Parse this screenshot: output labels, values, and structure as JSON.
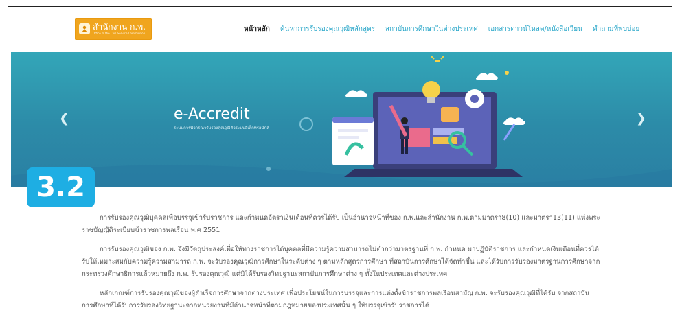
{
  "logo": {
    "title": "สำนักงาน ก.พ.",
    "subtitle": "Office of the Civil Service Commission"
  },
  "nav": {
    "items": [
      {
        "label": "หน้าหลัก",
        "active": true
      },
      {
        "label": "ค้นหาการรับรองคุณวุฒิหลักสูตร",
        "active": false
      },
      {
        "label": "สถาบันการศึกษาในต่างประเทศ",
        "active": false
      },
      {
        "label": "เอกสารดาวน์โหลด/หนังสือเวียน",
        "active": false
      },
      {
        "label": "คำถามที่พบบ่อย",
        "active": false
      }
    ]
  },
  "banner": {
    "title": "e-Accredit",
    "subtitle": "ระบบการพิจารณารับรองคุณวุฒิตัวระบบอิเล็กทรอนิกส์",
    "prev_icon": "chevron-left-icon",
    "next_icon": "chevron-right-icon",
    "colors": {
      "top": "#33a6b8",
      "bottom": "#2a7fa3"
    }
  },
  "badge": {
    "label": "3.2",
    "color": "#1eaee3"
  },
  "content": {
    "lines": [
      "การรับรองคุณวุฒิบุคคลเพื่อบรรจุเข้ารับราชการ และกำหนดอัตราเงินเดือนที่ควรได้รับ เป็นอำนาจหน้าที่ของ ก.พ.และสำนักงาน ก.พ.ตามมาตรา8(10) และมาตรา13(11) แห่งพระ",
      "ราชบัญญัติระเบียบข้าราชการพลเรือน พ.ศ 2551",
      "การรับรองคุณวุฒิของ ก.พ. จึงมีวัตถุประสงค์เพื่อให้ทางราชการได้บุคคลที่มีความรู้ความสามารถไม่ต่ำกว่ามาตรฐานที่ ก.พ. กำหนด มาปฏิบัติราชการ และกำหนดเงินเดือนที่ควรได้",
      "รับให้เหมาะสมกับความรู้ความสามารถ ก.พ. จะรับรองคุณวุฒิการศึกษาในระดับต่าง ๆ ตามหลักสูตรการศึกษา ที่สถาบันการศึกษาได้จัดทำขึ้น และได้รับการรับรองมาตรฐานการศึกษาจาก",
      "กระทรวงศึกษาธิการแล้วหมายถึง ก.พ. รับรองคุณวุฒิ แต่มิได้รับรองวิทยฐานะสถาบันการศึกษาต่าง ๆ ทั้งในประเทศและต่างประเทศ",
      "หลักเกณฑ์การรับรองคุณวุฒิของผู้สำเร็จการศึกษาจากต่างประเทศ เพื่อประโยชน์ในการบรรจุและการแต่งตั้งข้าราชการพลเรือนสามัญ ก.พ. จะรับรองคุณวุฒิที่ได้รับ จากสถาบัน",
      "การศึกษาที่ได้รับการรับรองวิทยฐานะจากหน่วยงานที่มีอำนาจหน้าที่ตามกฎหมายของประเทศนั้น ๆ ให้บรรจุเข้ารับราชการได้"
    ]
  }
}
